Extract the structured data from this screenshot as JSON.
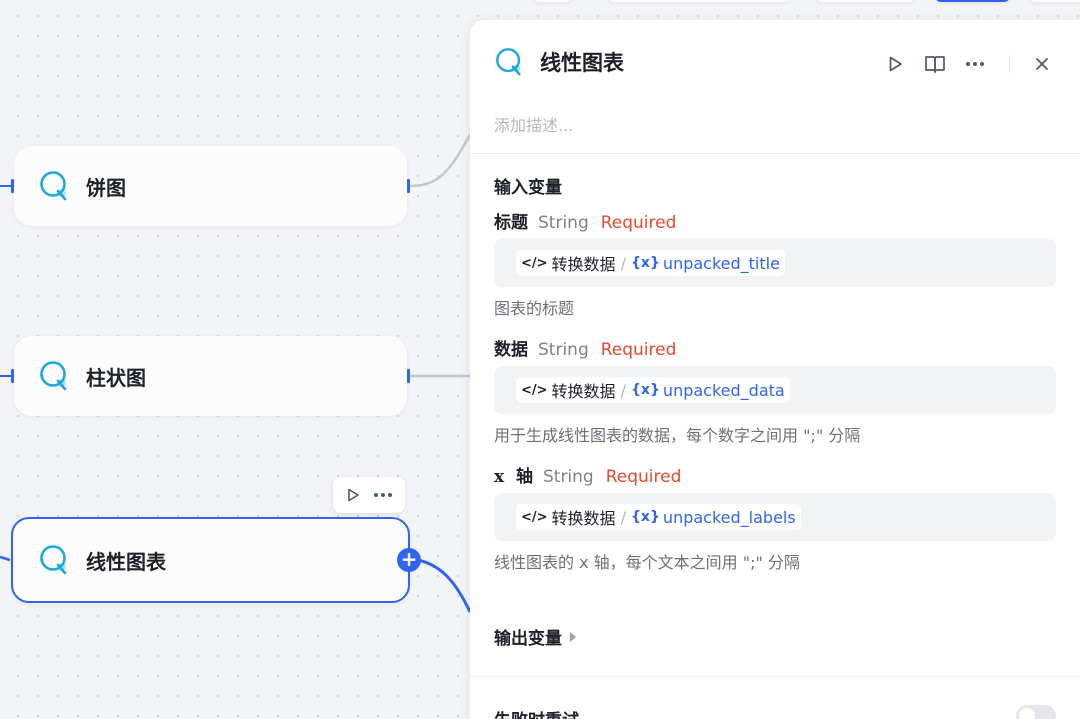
{
  "nodes": [
    {
      "label": "饼图"
    },
    {
      "label": "柱状图"
    },
    {
      "label": "线性图表"
    }
  ],
  "node_toolbar": {
    "run_icon": "play-icon",
    "more_icon": "more-dots-icon"
  },
  "panel": {
    "title": "线性图表",
    "description_placeholder": "添加描述...",
    "actions": [
      "play-icon",
      "book-icon",
      "more-dots-icon",
      "close-icon"
    ],
    "input_section_title": "输入变量",
    "inputs": [
      {
        "name": "标题",
        "type": "String",
        "required": "Required",
        "ref_node": "转换数据",
        "ref_var": "unpacked_title",
        "hint": "图表的标题"
      },
      {
        "name": "数据",
        "type": "String",
        "required": "Required",
        "ref_node": "转换数据",
        "ref_var": "unpacked_data",
        "hint": "用于生成线性图表的数据，每个数字之间用 \";\" 分隔"
      },
      {
        "name": "x  轴",
        "type": "String",
        "required": "Required",
        "ref_node": "转换数据",
        "ref_var": "unpacked_labels",
        "hint": "线性图表的 x 轴，每个文本之间用 \";\" 分隔"
      }
    ],
    "ref_code_glyph": "</>",
    "ref_slash": "/",
    "ref_var_glyph": "{x}",
    "output_section_title": "输出变量",
    "retry_title": "失败时重试"
  },
  "colors": {
    "accent": "#2f64f5",
    "required": "#e8492d"
  }
}
